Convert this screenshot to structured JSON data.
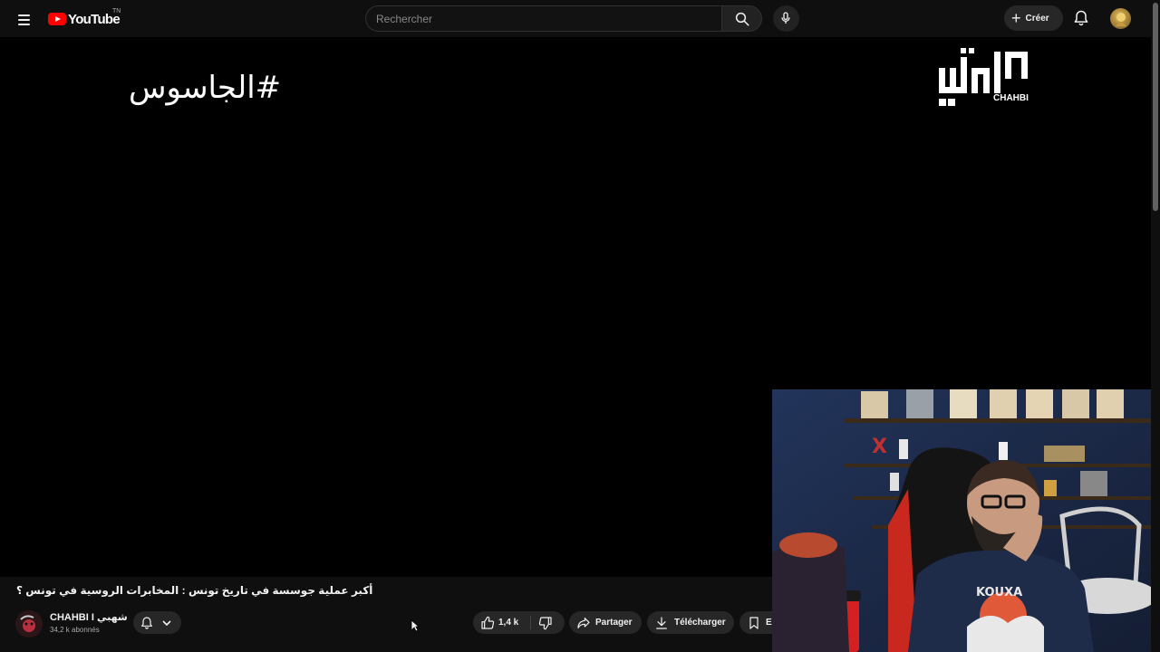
{
  "masthead": {
    "logo_text": "YouTube",
    "country_code": "TN",
    "search_placeholder": "Rechercher",
    "create_label": "Créer"
  },
  "player": {
    "overlay_hashtag": "#الجاسوس",
    "brand_logo_text": "CHAHBI"
  },
  "video": {
    "title": "أكبر عملية جوسسة في تاريخ تونس : المخابرات الروسية في تونس ؟",
    "channel_name": "CHAHBI I شهبي",
    "subscribers": "34,2 k abonnés",
    "likes": "1,4 k"
  },
  "actions": {
    "share_label": "Partager",
    "download_label": "Télécharger",
    "save_label_partial": "E"
  },
  "colors": {
    "background": "#0f0f0f",
    "player_bg": "#000000",
    "pill_bg": "#272727",
    "brand_red": "#ff0000",
    "text_primary": "#f1f1f1",
    "text_secondary": "#aaaaaa"
  }
}
